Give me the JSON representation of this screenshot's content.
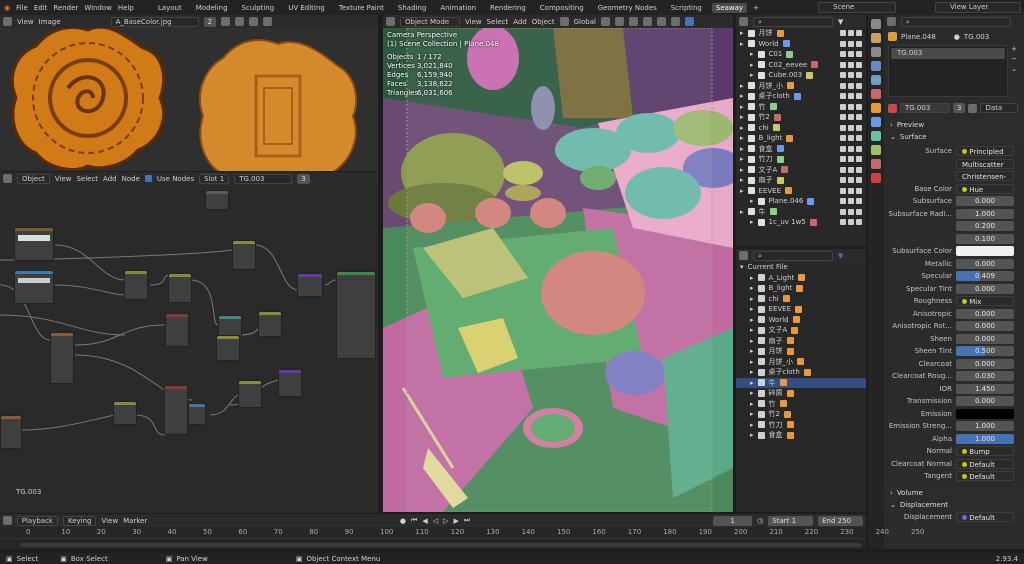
{
  "topbar": {
    "menus": [
      "File",
      "Edit",
      "Render",
      "Window",
      "Help"
    ],
    "tabs": [
      "Layout",
      "Modeling",
      "Sculpting",
      "UV Editing",
      "Texture Paint",
      "Shading",
      "Animation",
      "Rendering",
      "Compositing",
      "Geometry Nodes",
      "Scripting",
      "Seaway"
    ],
    "active_tab": "Seaway",
    "plus": "+",
    "scene": "Scene",
    "view_layer": "View Layer"
  },
  "image_editor": {
    "menus": [
      "View",
      "Image"
    ],
    "image_name": "A_BaseColor.jpg",
    "users": "2"
  },
  "node_editor": {
    "type": "Object",
    "menus": [
      "View",
      "Select",
      "Add",
      "Node"
    ],
    "use_nodes": "Use Nodes",
    "slot": "Slot 1",
    "material": "TG.003",
    "users": "3",
    "footer": "TG.003"
  },
  "viewport": {
    "mode": "Object Mode",
    "menus": [
      "View",
      "Select",
      "Add",
      "Object"
    ],
    "transform": "Global",
    "overlay_title": "Camera Perspective",
    "overlay_collection": "(1) Scene Collection | Plane.048",
    "stats": [
      {
        "k": "Objects",
        "v": "1 / 172"
      },
      {
        "k": "Vertices",
        "v": "3,021,840"
      },
      {
        "k": "Edges",
        "v": "6,159,940"
      },
      {
        "k": "Faces",
        "v": "3,138,622"
      },
      {
        "k": "Triangles",
        "v": "6,031,606"
      }
    ]
  },
  "outliner_top": {
    "items": [
      {
        "n": "月饼",
        "d": 0
      },
      {
        "n": "World",
        "d": 0
      },
      {
        "n": "C01",
        "d": 1
      },
      {
        "n": "C02_eevee",
        "d": 1
      },
      {
        "n": "Cube.003",
        "d": 1
      },
      {
        "n": "月饼_小",
        "d": 0
      },
      {
        "n": "桌子cloth",
        "d": 0
      },
      {
        "n": "竹",
        "d": 0
      },
      {
        "n": "竹2",
        "d": 0
      },
      {
        "n": "chi",
        "d": 0
      },
      {
        "n": "B_light",
        "d": 0
      },
      {
        "n": "食盒",
        "d": 0
      },
      {
        "n": "竹刀",
        "d": 0
      },
      {
        "n": "文子A",
        "d": 0
      },
      {
        "n": "扇子",
        "d": 0
      },
      {
        "n": "EEVEE",
        "d": 0
      },
      {
        "n": "Plane.046",
        "d": 1
      },
      {
        "n": "牛",
        "d": 0
      },
      {
        "n": "1c_uv 1w5",
        "d": 1
      }
    ]
  },
  "outliner_bottom": {
    "header": "Current File",
    "items": [
      "A_Light",
      "B_light",
      "chi",
      "EEVEE",
      "World",
      "文子A",
      "扇子",
      "月饼",
      "月饼_小",
      "桌子cloth",
      "牛",
      "碎屑",
      "竹",
      "竹2",
      "竹刀",
      "食盒"
    ],
    "selected": "牛"
  },
  "properties": {
    "object": "Plane.048",
    "material_name": "TG.003",
    "slot_item": "TG.003",
    "users": "3",
    "data": "Data",
    "sections": {
      "preview": "Preview",
      "surface": "Surface",
      "volume": "Volume",
      "displacement": "Displacement"
    },
    "fields": [
      {
        "k": "Surface",
        "v": "Principled BSDF",
        "type": "link"
      },
      {
        "k": "",
        "v": "Multiscatter GGX",
        "type": "dd"
      },
      {
        "k": "",
        "v": "Christensen-Burley",
        "type": "dd"
      },
      {
        "k": "Base Color",
        "v": "Hue Saturation Value",
        "type": "link"
      },
      {
        "k": "Subsurface",
        "v": "0.000",
        "type": "num"
      },
      {
        "k": "Subsurface Radi...",
        "v": "1.000",
        "type": "num"
      },
      {
        "k": "",
        "v": "0.200",
        "type": "num"
      },
      {
        "k": "",
        "v": "0.100",
        "type": "num"
      },
      {
        "k": "Subsurface Color",
        "v": "",
        "type": "white"
      },
      {
        "k": "Metallic",
        "v": "0.000",
        "type": "num"
      },
      {
        "k": "Specular",
        "v": "0.409",
        "type": "bar",
        "f": 0.409
      },
      {
        "k": "Specular Tint",
        "v": "0.000",
        "type": "num"
      },
      {
        "k": "Roughness",
        "v": "Mix",
        "type": "link"
      },
      {
        "k": "Anisotropic",
        "v": "0.000",
        "type": "num"
      },
      {
        "k": "Anisotropic Rot...",
        "v": "0.000",
        "type": "num"
      },
      {
        "k": "Sheen",
        "v": "0.000",
        "type": "num"
      },
      {
        "k": "Sheen Tint",
        "v": "0.500",
        "type": "bar",
        "f": 0.5
      },
      {
        "k": "Clearcoat",
        "v": "0.000",
        "type": "num"
      },
      {
        "k": "Clearcoat Roug...",
        "v": "0.030",
        "type": "num"
      },
      {
        "k": "IOR",
        "v": "1.450",
        "type": "num"
      },
      {
        "k": "Transmission",
        "v": "0.000",
        "type": "num"
      },
      {
        "k": "Emission",
        "v": "",
        "type": "black"
      },
      {
        "k": "Emission Streng...",
        "v": "1.000",
        "type": "num"
      },
      {
        "k": "Alpha",
        "v": "1.000",
        "type": "bar",
        "f": 1.0
      },
      {
        "k": "Normal",
        "v": "Bump",
        "type": "link"
      },
      {
        "k": "Clearcoat Normal",
        "v": "Default",
        "type": "link"
      },
      {
        "k": "Tangent",
        "v": "Default",
        "type": "link"
      }
    ],
    "disp_field": {
      "k": "Displacement",
      "v": "Default"
    }
  },
  "timeline": {
    "menus": [
      "Playback",
      "Keying",
      "View",
      "Marker"
    ],
    "frame": "1",
    "start_label": "Start",
    "start": "1",
    "end_label": "End",
    "end": "250",
    "ticks": [
      "0",
      "10",
      "20",
      "30",
      "40",
      "50",
      "60",
      "70",
      "80",
      "90",
      "100",
      "110",
      "120",
      "130",
      "140",
      "150",
      "160",
      "170",
      "180",
      "190",
      "200",
      "210",
      "220",
      "230",
      "240",
      "250"
    ],
    "current": "1"
  },
  "statusbar": {
    "items": [
      "Select",
      "Box Select",
      "Pan View",
      "Object Context Menu"
    ],
    "version": "2.93.4"
  }
}
